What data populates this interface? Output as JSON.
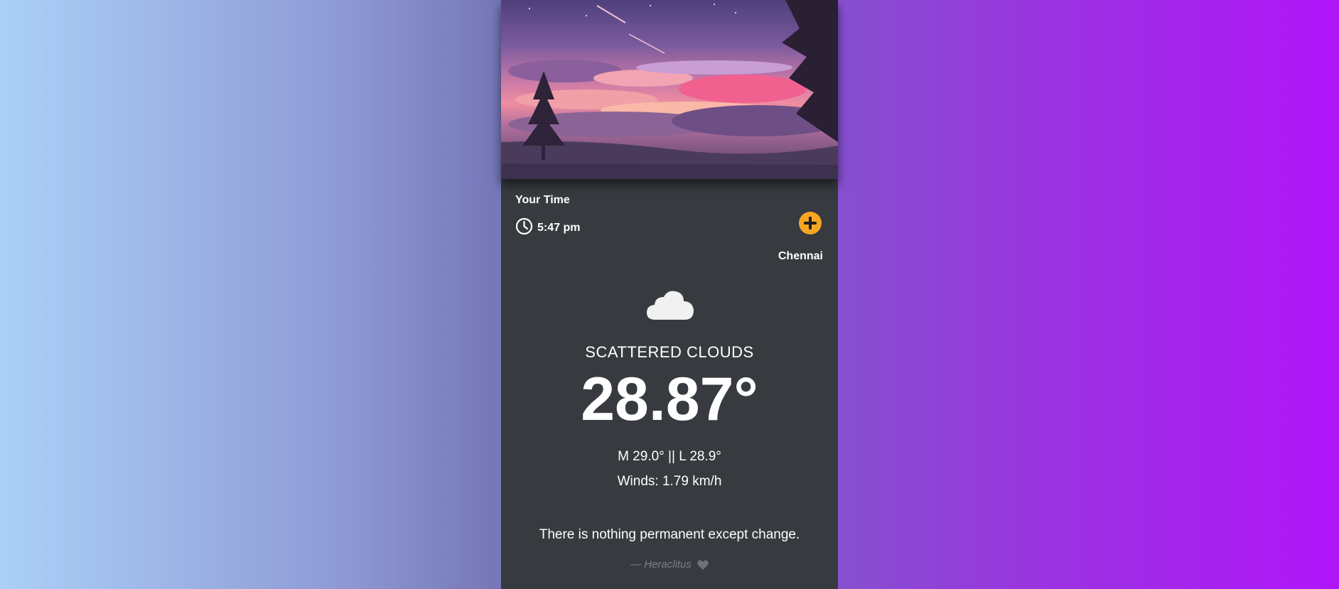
{
  "time_section": {
    "label": "Your Time",
    "time": "5:47 pm"
  },
  "location": {
    "city": "Chennai",
    "add_icon": "plus-circle-icon"
  },
  "weather": {
    "icon": "cloud-icon",
    "condition": "SCATTERED CLOUDS",
    "temperature": "28.87°",
    "min_max": "M 29.0° || L 28.9°",
    "winds": "Winds: 1.79 km/h"
  },
  "quote": {
    "text": "There is nothing permanent except change.",
    "author": "— Heraclitus",
    "heart_icon": "heart-icon"
  },
  "colors": {
    "card_bg": "#373a3f",
    "accent": "#f5a623",
    "muted_text": "#7d8086"
  }
}
